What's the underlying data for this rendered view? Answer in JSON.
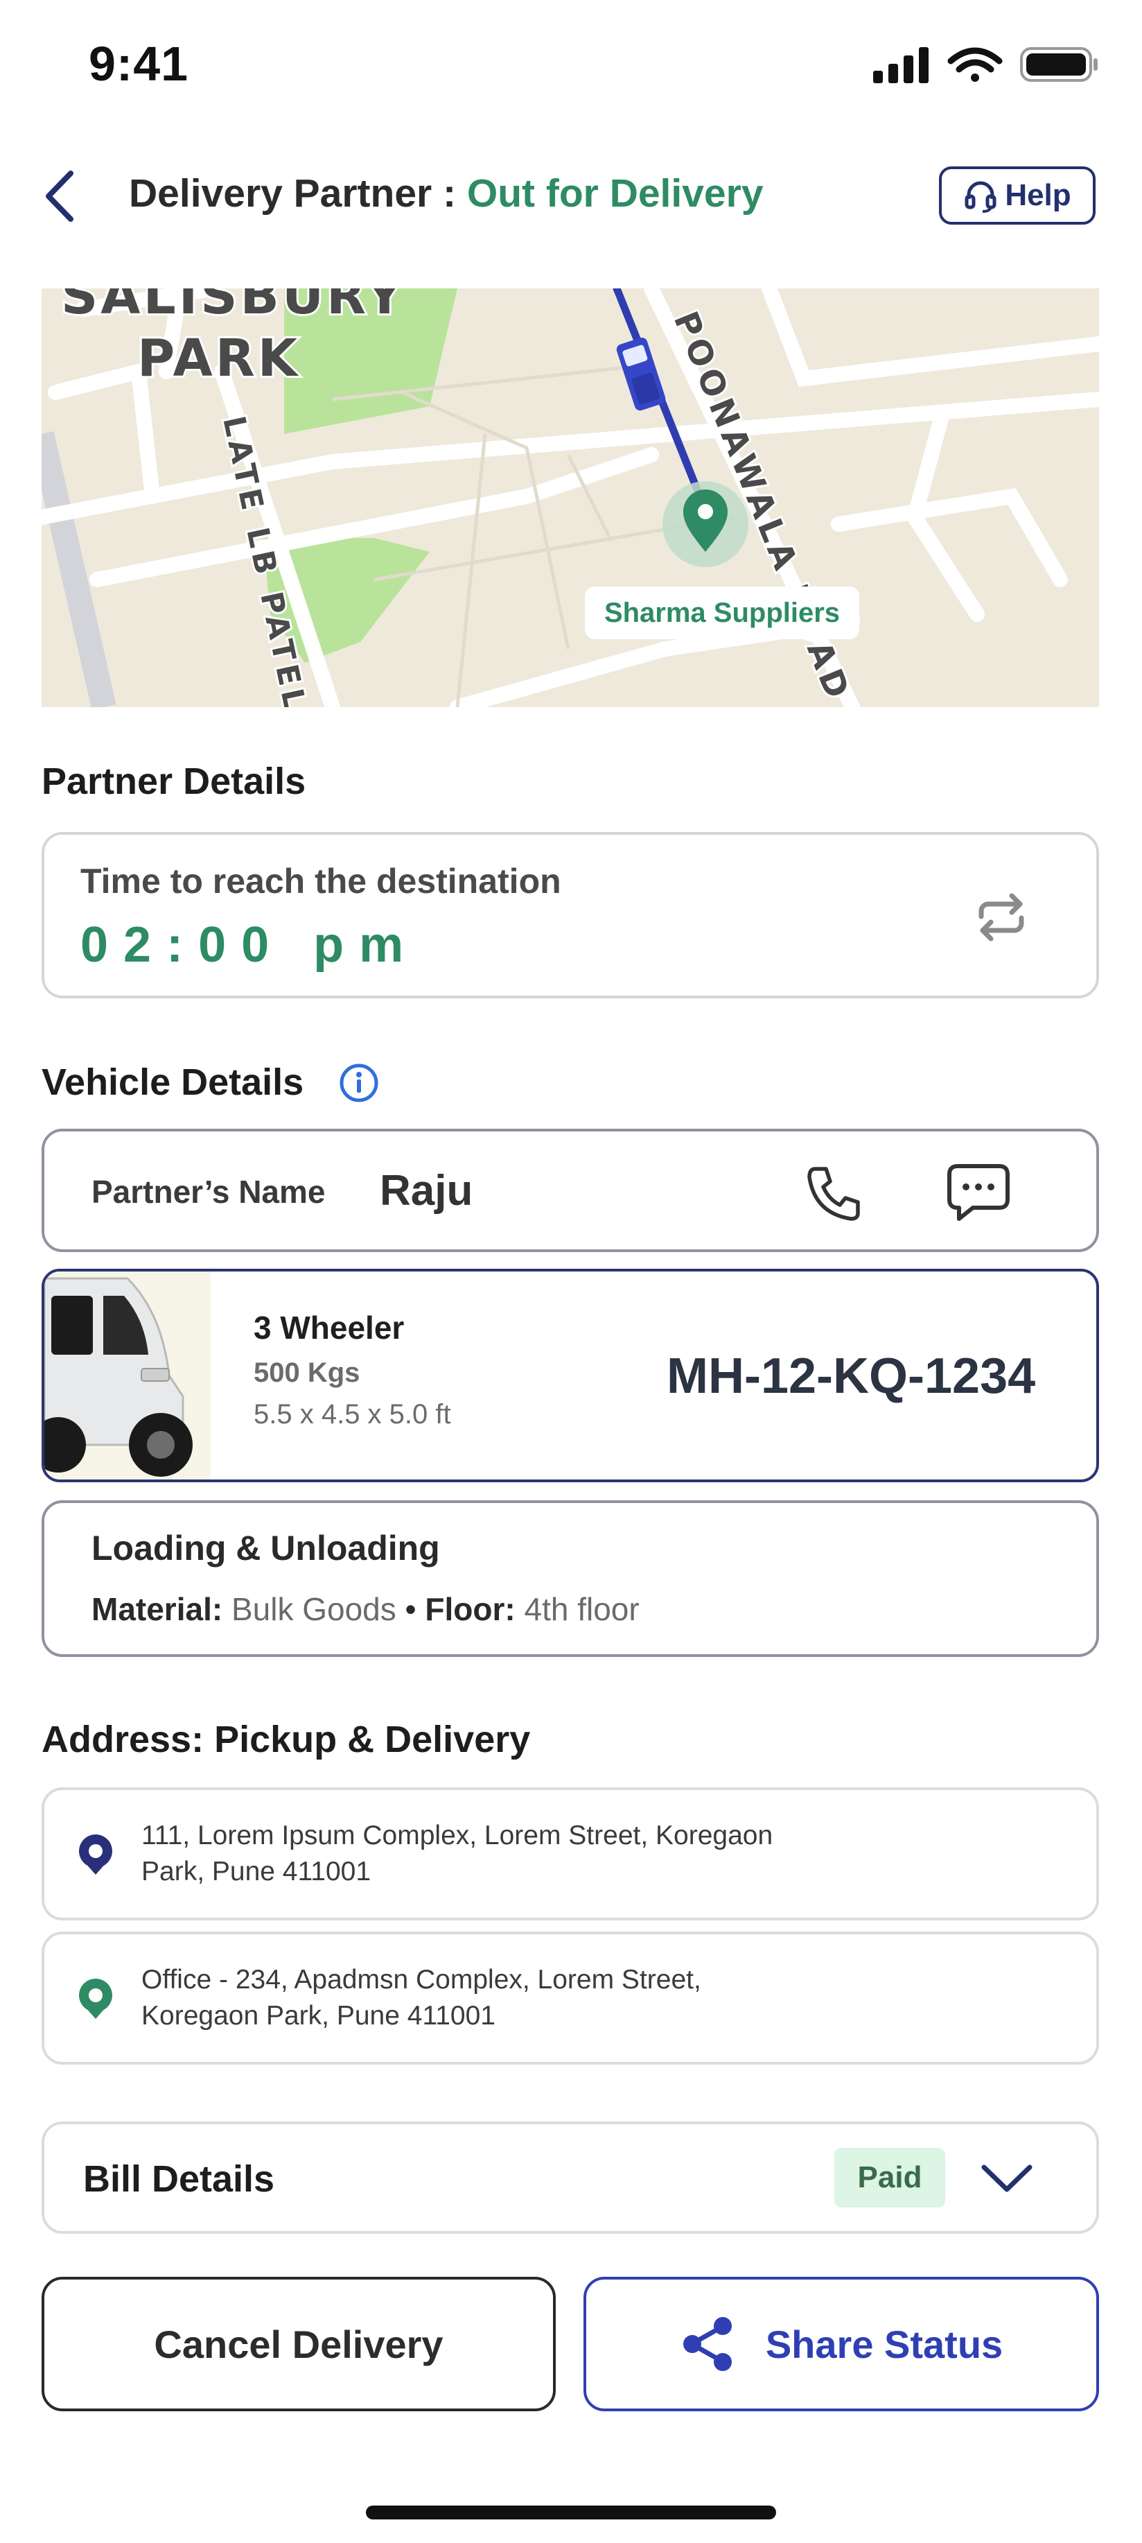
{
  "status_bar": {
    "time": "9:41"
  },
  "header": {
    "title_prefix": "Delivery Partner : ",
    "title_status": "Out for Delivery",
    "help_label": "Help",
    "back_icon": "chevron-left-icon",
    "help_icon": "headset-icon"
  },
  "map": {
    "area_label_1": "SALISBURY",
    "area_label_2": "PARK",
    "street_1": "POONAWALA ROAD",
    "street_2": "LATE LB PATEL",
    "destination_label": "Sharma Suppliers"
  },
  "partner_details": {
    "section_title": "Partner Details",
    "eta_label": "Time to reach the destination",
    "eta_value": "02:00 pm",
    "refresh_icon": "refresh-icon"
  },
  "vehicle_details": {
    "section_title": "Vehicle Details",
    "info_icon": "info-icon",
    "partner_name_label": "Partner’s Name",
    "partner_name": "Raju",
    "vehicle_type": "3 Wheeler",
    "capacity": "500 Kgs",
    "dimensions": "5.5 x 4.5 x 5.0 ft",
    "registration": "MH-12-KQ-1234"
  },
  "loading": {
    "title": "Loading & Unloading",
    "material_label": "Material:",
    "material_value": "Bulk Goods",
    "separator": "•",
    "floor_label": "Floor:",
    "floor_value": "4th floor"
  },
  "address": {
    "section_title": "Address: Pickup & Delivery",
    "pickup_line1": "111, Lorem Ipsum Complex, Lorem Street, Koregaon",
    "pickup_line2": "Park, Pune 411001",
    "delivery_line1": "Office - 234, Apadmsn Complex, Lorem Street,",
    "delivery_line2": "Koregaon Park, Pune 411001"
  },
  "bill": {
    "title": "Bill Details",
    "status": "Paid"
  },
  "actions": {
    "cancel_label": "Cancel Delivery",
    "share_label": "Share Status"
  },
  "colors": {
    "accent_green": "#2e8b64",
    "brand_navy": "#23306e",
    "share_blue": "#2f3fb3",
    "paid_bg": "#dcf5e4"
  }
}
